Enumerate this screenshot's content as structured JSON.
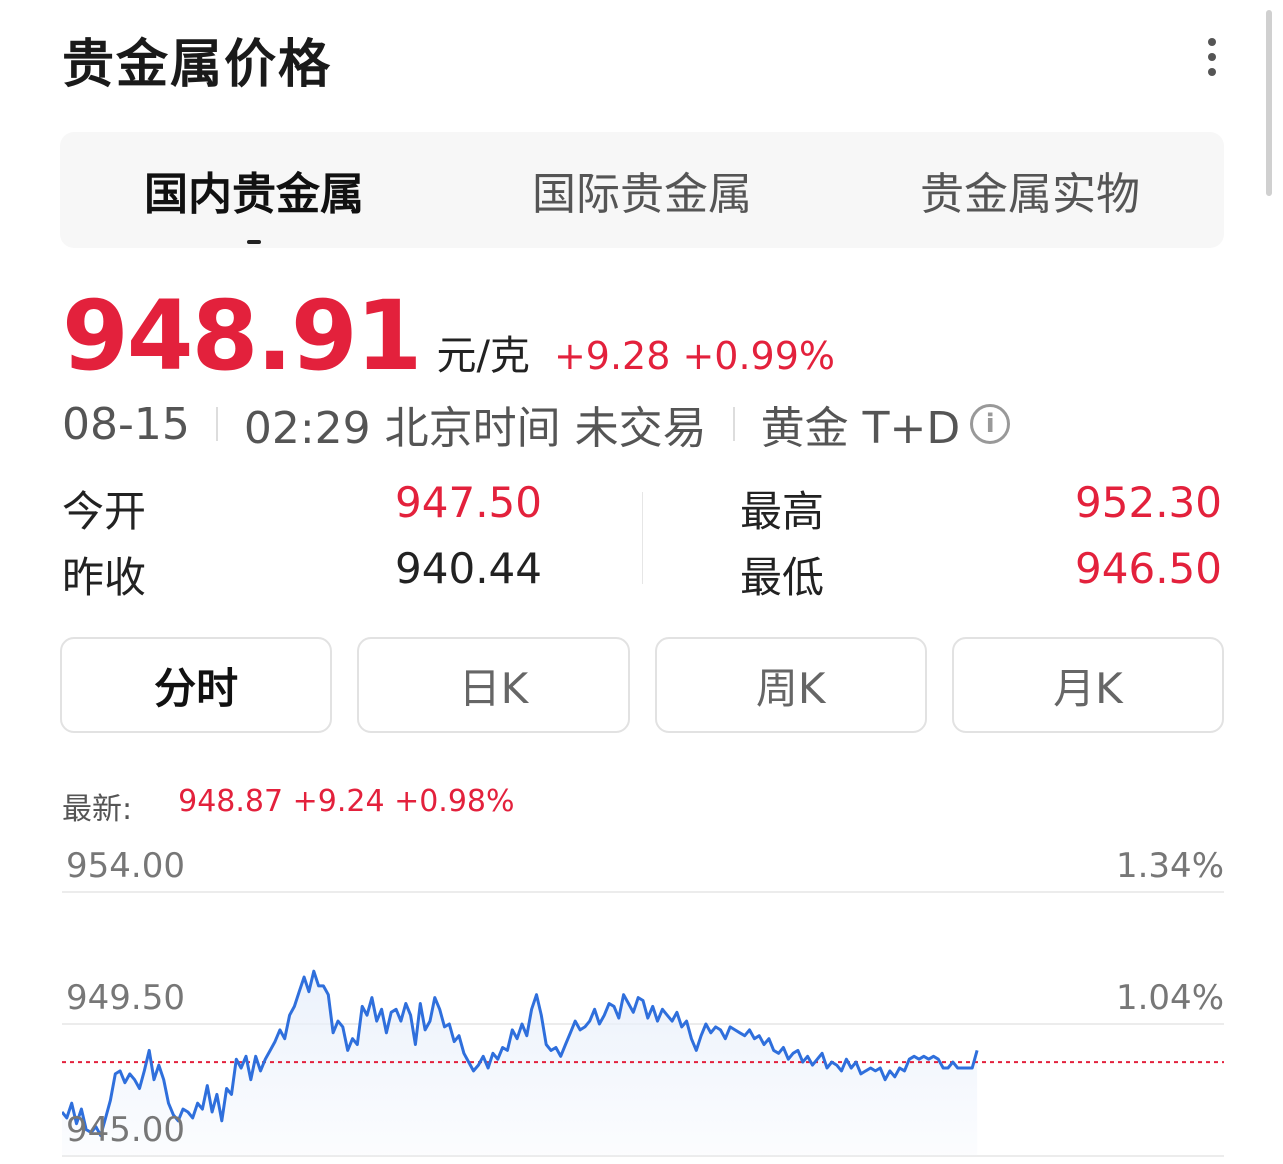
{
  "header": {
    "title": "贵金属价格"
  },
  "tabs": [
    {
      "label": "国内贵金属",
      "active": true
    },
    {
      "label": "国际贵金属",
      "active": false
    },
    {
      "label": "贵金属实物",
      "active": false
    }
  ],
  "quote": {
    "price": "948.91",
    "unit": "元/克",
    "change": "+9.28 +0.99%"
  },
  "meta": {
    "date": "08-15",
    "time_status": "02:29 北京时间 未交易",
    "product": "黄金 T+D",
    "info_icon": "info-icon"
  },
  "stats": {
    "open_label": "今开",
    "open_value": "947.50",
    "prev_close_label": "昨收",
    "prev_close_value": "940.44",
    "high_label": "最高",
    "high_value": "952.30",
    "low_label": "最低",
    "low_value": "946.50"
  },
  "periods": [
    {
      "label": "分时",
      "active": true
    },
    {
      "label": "日K",
      "active": false
    },
    {
      "label": "周K",
      "active": false
    },
    {
      "label": "月K",
      "active": false
    }
  ],
  "latest": {
    "label": "最新:",
    "values": "948.87 +9.24 +0.98%"
  },
  "colors": {
    "up": "#e3213c",
    "line": "#2f6fdc",
    "area": "#e9f0fb",
    "ref": "#e3213c"
  },
  "chart_data": {
    "type": "line",
    "y_ticks_left": [
      "954.00",
      "949.50",
      "945.00"
    ],
    "y_ticks_right": [
      "1.34%",
      "1.04%",
      ""
    ],
    "ylim": [
      945.0,
      954.0
    ],
    "reference": 948.2,
    "x_slots": 240,
    "values": [
      946.5,
      946.3,
      946.8,
      946.1,
      946.6,
      945.9,
      945.8,
      946.0,
      945.7,
      946.3,
      946.9,
      947.8,
      947.9,
      947.5,
      947.8,
      947.6,
      947.3,
      947.9,
      948.6,
      947.6,
      948.1,
      947.6,
      946.8,
      946.4,
      946.2,
      946.6,
      946.5,
      946.3,
      946.8,
      946.6,
      947.4,
      946.5,
      947.1,
      946.2,
      947.3,
      947.1,
      948.3,
      948.0,
      948.4,
      947.6,
      948.4,
      947.9,
      948.3,
      948.6,
      948.9,
      949.3,
      949.0,
      949.8,
      950.1,
      950.6,
      951.1,
      950.6,
      951.3,
      950.8,
      950.8,
      950.5,
      949.2,
      949.6,
      949.4,
      948.6,
      949.0,
      948.8,
      950.1,
      949.8,
      950.4,
      949.6,
      950.0,
      949.2,
      949.9,
      950.0,
      949.6,
      950.2,
      949.8,
      948.8,
      950.2,
      949.3,
      949.6,
      950.4,
      950.0,
      949.4,
      949.5,
      948.9,
      949.1,
      948.5,
      948.2,
      947.9,
      948.1,
      948.4,
      948.0,
      948.5,
      948.3,
      948.7,
      948.6,
      949.3,
      949.0,
      949.5,
      949.1,
      950.0,
      950.5,
      949.8,
      948.8,
      948.6,
      948.7,
      948.4,
      948.8,
      949.2,
      949.6,
      949.3,
      949.4,
      949.6,
      950.0,
      949.5,
      949.8,
      950.2,
      950.1,
      949.7,
      950.5,
      950.2,
      949.9,
      950.4,
      950.3,
      949.7,
      950.1,
      949.6,
      950.0,
      949.8,
      949.6,
      949.9,
      949.4,
      949.6,
      949.0,
      948.6,
      949.1,
      949.5,
      949.2,
      949.4,
      949.3,
      949.0,
      949.4,
      949.3,
      949.2,
      949.1,
      949.3,
      949.0,
      949.1,
      948.8,
      949.0,
      948.6,
      948.5,
      948.7,
      948.3,
      948.5,
      948.6,
      948.2,
      948.4,
      948.1,
      948.3,
      948.5,
      948.0,
      948.2,
      948.1,
      947.9,
      948.3,
      948.0,
      948.2,
      947.8,
      947.9,
      948.0,
      947.9,
      948.0,
      947.6,
      947.9,
      947.7,
      948.0,
      947.9,
      948.3,
      948.4,
      948.3,
      948.4,
      948.3,
      948.4,
      948.3,
      948.0,
      948.0,
      948.2,
      948.0,
      948.0,
      948.0,
      948.0,
      948.6
    ]
  }
}
